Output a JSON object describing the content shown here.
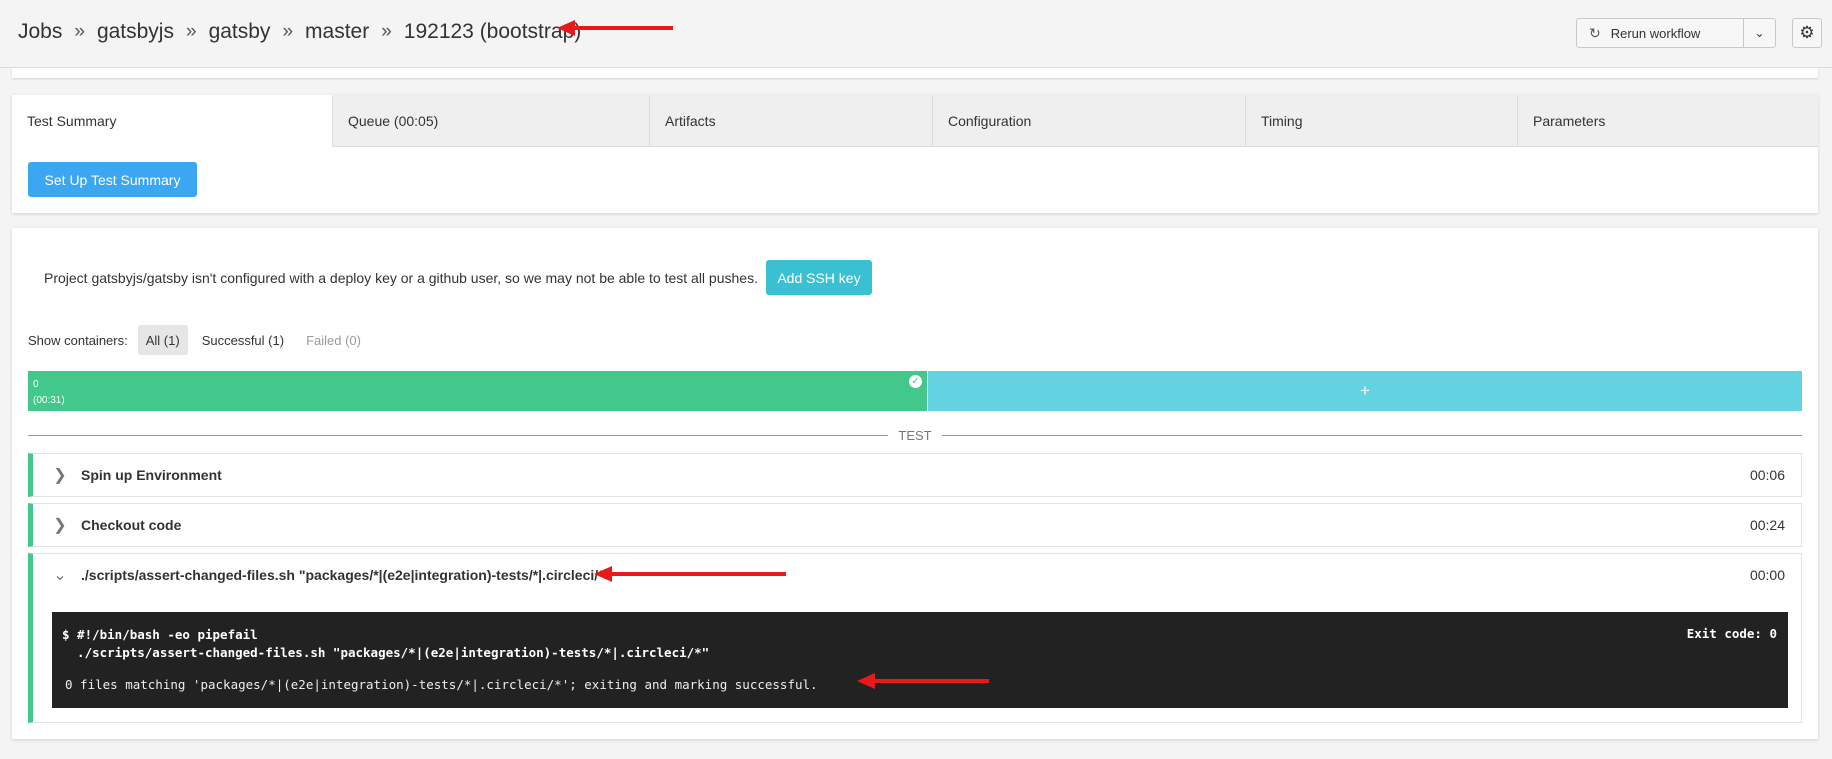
{
  "header": {
    "breadcrumb": [
      "Jobs",
      "gatsbyjs",
      "gatsby",
      "master",
      "192123 (bootstrap)"
    ],
    "separator": "»",
    "rerun_label": "Rerun workflow",
    "rerun_icon": "refresh-icon",
    "caret_icon": "chevron-down-icon",
    "settings_icon": "gear-icon"
  },
  "tabs": [
    {
      "label": "Test Summary",
      "active": true
    },
    {
      "label": "Queue (00:05)",
      "active": false
    },
    {
      "label": "Artifacts",
      "active": false
    },
    {
      "label": "Configuration",
      "active": false
    },
    {
      "label": "Timing",
      "active": false
    },
    {
      "label": "Parameters",
      "active": false
    }
  ],
  "setup_button": "Set Up Test Summary",
  "notice": {
    "text": "Project gatsbyjs/gatsby isn't configured with a deploy key or a github user, so we may not be able to test all pushes.",
    "button": "Add SSH key"
  },
  "containers": {
    "label": "Show containers:",
    "filters": [
      "All (1)",
      "Successful (1)",
      "Failed (0)"
    ]
  },
  "progress": {
    "index": "0",
    "duration": "(00:31)",
    "add_label": "+"
  },
  "section_label": "TEST",
  "steps": [
    {
      "name": "Spin up Environment",
      "time": "00:06"
    },
    {
      "name": "Checkout code",
      "time": "00:24"
    },
    {
      "name": "./scripts/assert-changed-files.sh \"packages/*|(e2e|integration)-tests/*|.circleci/*\"",
      "time": "00:00"
    }
  ],
  "terminal": {
    "line1": "$ #!/bin/bash -eo pipefail",
    "line2": "  ./scripts/assert-changed-files.sh \"packages/*|(e2e|integration)-tests/*|.circleci/*\"",
    "exit": "Exit code: 0",
    "output": "0 files matching 'packages/*|(e2e|integration)-tests/*|.circleci/*'; exiting and marking successful."
  },
  "colors": {
    "success": "#42c88a",
    "primary": "#3ba6f2",
    "info": "#39c1d3",
    "annotation": "#e81919"
  }
}
